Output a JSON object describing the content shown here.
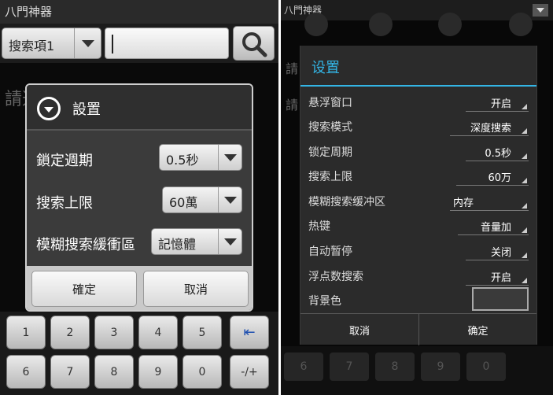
{
  "left": {
    "app_title": "八門神器",
    "search_type": "搜索項1",
    "search_input_value": "",
    "background_text": "請選擇應用程式",
    "dialog": {
      "title": "設置",
      "rows": [
        {
          "label": "鎖定週期",
          "value": "0.5秒"
        },
        {
          "label": "搜索上限",
          "value": "60萬"
        },
        {
          "label": "模糊搜索緩衝區",
          "value": "記憶體"
        }
      ],
      "ok_label": "確定",
      "cancel_label": "取消"
    },
    "keypad_row1": [
      "1",
      "2",
      "3",
      "4",
      "5",
      "⇤"
    ],
    "keypad_row2": [
      "6",
      "7",
      "8",
      "9",
      "0",
      "-/+"
    ]
  },
  "right": {
    "app_title": "八門神器",
    "side_text_1": "請",
    "side_text_2": "請",
    "dialog": {
      "title": "设置",
      "rows": [
        {
          "label": "悬浮窗口",
          "value": "开启"
        },
        {
          "label": "搜索模式",
          "value": "深度搜索"
        },
        {
          "label": "锁定周期",
          "value": "0.5秒"
        },
        {
          "label": "搜索上限",
          "value": "60万"
        },
        {
          "label": "模糊搜索缓冲区",
          "value": "内存"
        },
        {
          "label": "热键",
          "value": "音量加"
        },
        {
          "label": "自动暂停",
          "value": "关闭"
        },
        {
          "label": "浮点数搜索",
          "value": "开启"
        }
      ],
      "bg_color_label": "背景色",
      "cancel_label": "取消",
      "ok_label": "确定"
    },
    "keypad": [
      "6",
      "7",
      "8",
      "9",
      "0"
    ]
  },
  "colors": {
    "accent": "#33b5e5",
    "dialog_bg_left": "#3b3b3b",
    "dialog_bg_right": "#2b2b2b"
  }
}
